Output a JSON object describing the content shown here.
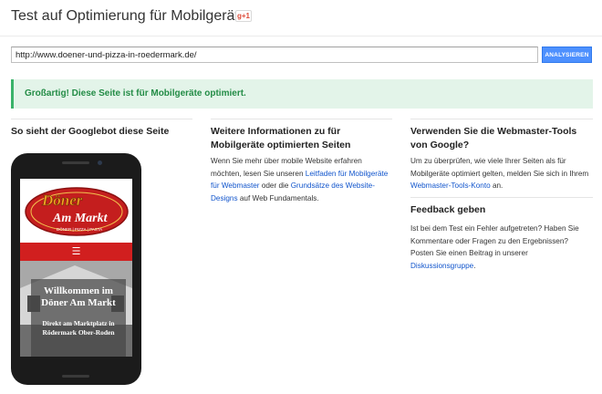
{
  "header": {
    "title": "Test auf Optimierung für Mobilgeräte",
    "gplus_label": "g+1"
  },
  "analyze": {
    "url_value": "http://www.doener-und-pizza-in-roedermark.de/",
    "button_label": "ANALYSIEREN"
  },
  "result": {
    "message": "Großartig! Diese Seite ist für Mobilgeräte optimiert."
  },
  "preview": {
    "heading": "So sieht der Googlebot diese Seite",
    "site_logo_top": "Döner",
    "site_logo_bottom": "Am Markt",
    "site_tagline": "DÖNER | PIZZA | PASTA",
    "menu_icon": "☰",
    "overlay_title": "Willkommen im Döner Am Markt",
    "overlay_subtitle": "Direkt am Marktplatz in Rödermark Ober-Roden"
  },
  "info": {
    "heading": "Weitere Informationen zu für Mobilgeräte optimierten Seiten",
    "text_1": "Wenn Sie mehr über mobile Website erfahren möchten, lesen Sie unseren ",
    "link_1": "Leitfaden für Mobilgeräte für Webmaster",
    "text_2": " oder die ",
    "link_2": "Grundsätze des Website-Designs",
    "text_3": " auf Web Fundamentals."
  },
  "webmaster": {
    "heading": "Verwenden Sie die Webmaster-Tools von Google?",
    "text_1": "Um zu überprüfen, wie viele Ihrer Seiten als für Mobilgeräte optimiert gelten, melden Sie sich in Ihrem ",
    "link": "Webmaster-Tools-Konto",
    "text_2": " an."
  },
  "feedback": {
    "heading": "Feedback geben",
    "text_1": "Ist bei dem Test ein Fehler aufgetreten? Haben Sie Kommentare oder Fragen zu den Ergebnissen? Posten Sie einen Beitrag in unserer ",
    "link": "Diskussionsgruppe",
    "text_2": "."
  },
  "colors": {
    "accent_blue": "#4d90fe",
    "link_blue": "#1155cc",
    "success_green": "#238c46",
    "success_bg": "#e3f4e9",
    "site_red": "#d11f1f"
  }
}
